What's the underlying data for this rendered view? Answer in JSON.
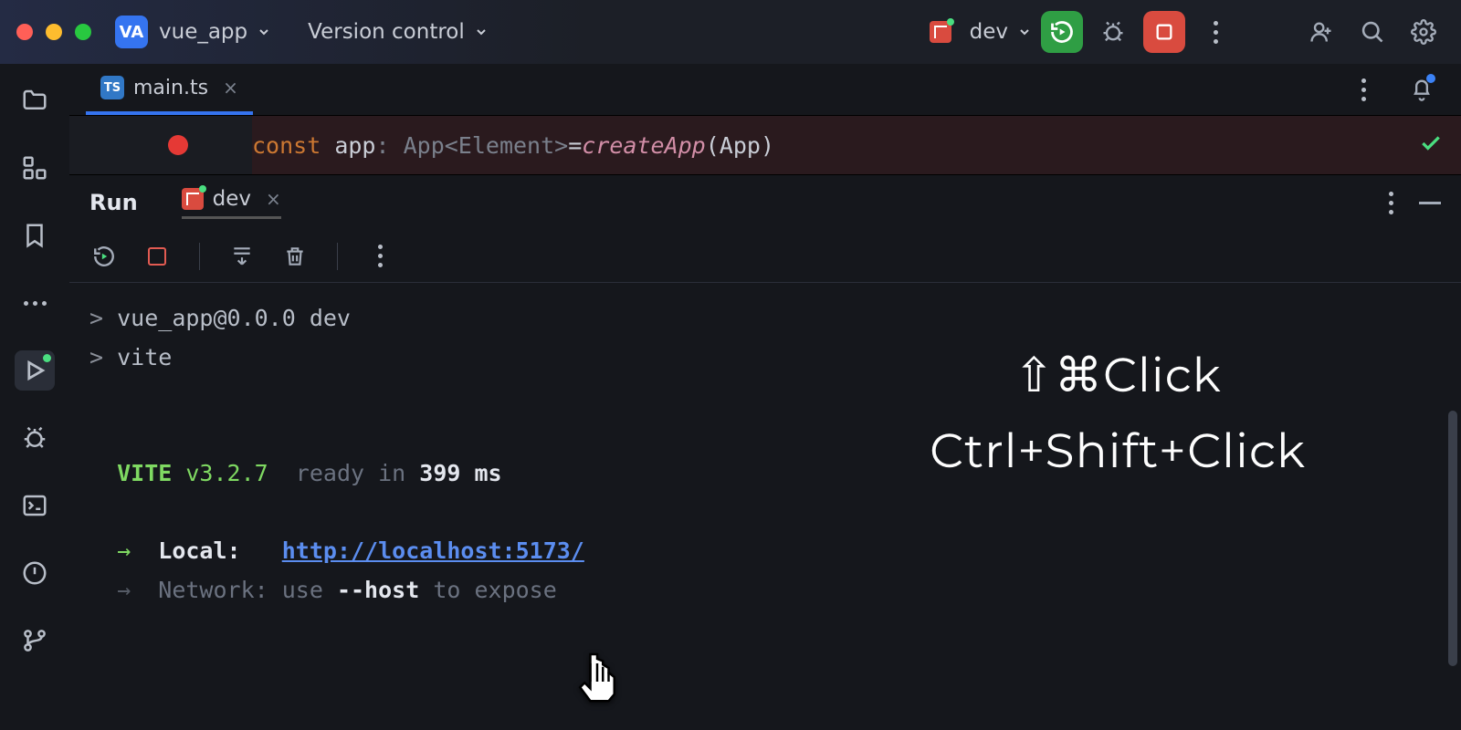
{
  "titlebar": {
    "project_badge": "VA",
    "project_name": "vue_app",
    "vcs_label": "Version control",
    "run_config": "dev"
  },
  "file_tab": {
    "badge": "TS",
    "name": "main.ts"
  },
  "code": {
    "kw": "const",
    "ident": "app",
    "type": " : App<Element>  ",
    "eq": "= ",
    "fn": "createApp",
    "args": "(App)"
  },
  "run_panel": {
    "label": "Run",
    "tab": "dev"
  },
  "console": {
    "l1_prefix": "> ",
    "l1": "vue_app@0.0.0 dev",
    "l2_prefix": "> ",
    "l2": "vite",
    "vite_name": "VITE",
    "vite_ver": " v3.2.7",
    "ready_pre": "  ready in ",
    "ready_ms": "399",
    "ready_suf": " ms",
    "local_arrow": "→  ",
    "local_label": "Local:   ",
    "local_url": "http://localhost:5173/",
    "net_arrow": "→  ",
    "net_label": "Network: ",
    "net_use": "use ",
    "net_flag": "--host",
    "net_rest": " to expose"
  },
  "overlay": {
    "mac": "⇧⌘Click",
    "win": "Ctrl+Shift+Click"
  }
}
